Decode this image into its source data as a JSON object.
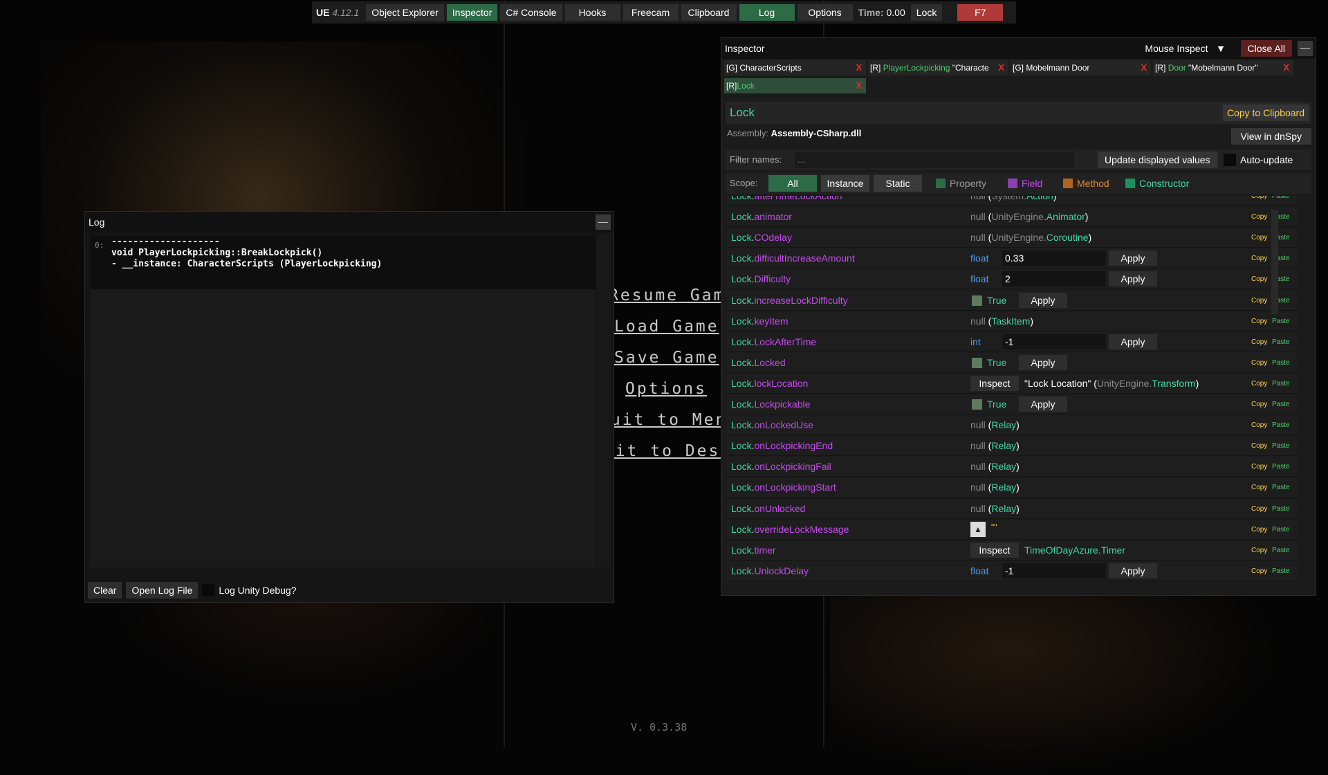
{
  "topbar": {
    "brand": "UE",
    "version": "4.12.1",
    "buttons": [
      "Object Explorer",
      "Inspector",
      "C# Console",
      "Hooks",
      "Freecam",
      "Clipboard",
      "Log",
      "Options"
    ],
    "time_label": "Time:",
    "time_value": "0.00",
    "lock_label": "Lock",
    "hotkey": "F7"
  },
  "background": {
    "menu_items": [
      "Resume Game",
      "Load Game",
      "Save Game",
      "Options",
      "Quit to Menu",
      "Quit to Desktop"
    ],
    "version": "V. 0.3.38"
  },
  "log": {
    "title": "Log",
    "minimize": "—",
    "index": "0:",
    "text": "--------------------\nvoid PlayerLockpicking::BreakLockpick()\n- __instance: CharacterScripts (PlayerLockpicking)",
    "clear_label": "Clear",
    "open_label": "Open Log File",
    "unity_debug_label": "Log Unity Debug?"
  },
  "inspector": {
    "title": "Inspector",
    "mouse_inspect": "Mouse Inspect",
    "close_all": "Close All",
    "minimize": "—",
    "tabs": [
      {
        "prefix": "[G]",
        "name": "CharacterScripts",
        "suffix": ""
      },
      {
        "prefix": "[R]",
        "name": "PlayerLockpicking",
        "suffix": " \"Characte"
      },
      {
        "prefix": "[G]",
        "name": "Mobelmann Door",
        "suffix": ""
      },
      {
        "prefix": "[R]",
        "name": "Door",
        "suffix": " \"Mobelmann Door\""
      },
      {
        "prefix": "[R]",
        "name": "Lock",
        "suffix": ""
      }
    ],
    "tab_close": "X",
    "class_name": "Lock",
    "copy_clipboard": "Copy to Clipboard",
    "assembly_label": "Assembly:",
    "assembly_value": "Assembly-CSharp.dll",
    "view_dnspy": "View in dnSpy",
    "filter_label": "Filter names:",
    "filter_placeholder": "...",
    "update_values": "Update displayed values",
    "auto_update": "Auto-update",
    "scope_label": "Scope:",
    "scope_buttons": [
      "All",
      "Instance",
      "Static"
    ],
    "legend": [
      {
        "label": "Property",
        "color": "#2c6b46",
        "text_color": "#9b9b9b"
      },
      {
        "label": "Field",
        "color": "#8b3fb0",
        "text_color": "#c64cf0"
      },
      {
        "label": "Method",
        "color": "#b0631f",
        "text_color": "#e08a3a"
      },
      {
        "label": "Constructor",
        "color": "#1f8f60",
        "text_color": "#40d7a8"
      }
    ],
    "copy_label": "Copy",
    "paste_label": "Paste",
    "apply_label": "Apply",
    "inspect_label": "Inspect",
    "members": [
      {
        "cls": "Lock",
        "name": "afterTimeLockAction",
        "null": "null",
        "ns": "System.",
        "type": "Action"
      },
      {
        "cls": "Lock",
        "name": "animator",
        "null": "null",
        "ns": "UnityEngine.",
        "type": "Animator"
      },
      {
        "cls": "Lock",
        "name": "COdelay",
        "null": "null",
        "ns": "UnityEngine.",
        "type": "Coroutine"
      },
      {
        "cls": "Lock",
        "name": "difficultIncreaseAmount",
        "kw": "float",
        "value": "0.33"
      },
      {
        "cls": "Lock",
        "name": "Difficulty",
        "kw": "float",
        "value": "2"
      },
      {
        "cls": "Lock",
        "name": "increaseLockDifficulty",
        "bool": "True"
      },
      {
        "cls": "Lock",
        "name": "keyItem",
        "null": "null",
        "ns": "",
        "type": "TaskItem"
      },
      {
        "cls": "Lock",
        "name": "LockAfterTime",
        "kw": "int",
        "value": "-1"
      },
      {
        "cls": "Lock",
        "name": "Locked",
        "bool": "True"
      },
      {
        "cls": "Lock",
        "name": "lockLocation",
        "inspect_text": "\"Lock Location\"",
        "ns": "UnityEngine.",
        "type": "Transform"
      },
      {
        "cls": "Lock",
        "name": "Lockpickable",
        "bool": "True"
      },
      {
        "cls": "Lock",
        "name": "onLockedUse",
        "null": "null",
        "ns": "",
        "type": "Relay"
      },
      {
        "cls": "Lock",
        "name": "onLockpickingEnd",
        "null": "null",
        "ns": "",
        "type": "Relay"
      },
      {
        "cls": "Lock",
        "name": "onLockpickingFail",
        "null": "null",
        "ns": "",
        "type": "Relay"
      },
      {
        "cls": "Lock",
        "name": "onLockpickingStart",
        "null": "null",
        "ns": "",
        "type": "Relay"
      },
      {
        "cls": "Lock",
        "name": "onUnlocked",
        "null": "null",
        "ns": "",
        "type": "Relay"
      },
      {
        "cls": "Lock",
        "name": "overrideLockMessage",
        "expand": "▲",
        "value": "\"\""
      },
      {
        "cls": "Lock",
        "name": "timer",
        "inspect_plain": "TimeOfDayAzure.Timer"
      },
      {
        "cls": "Lock",
        "name": "UnlockDelay",
        "kw": "float",
        "value": "-1"
      }
    ]
  }
}
